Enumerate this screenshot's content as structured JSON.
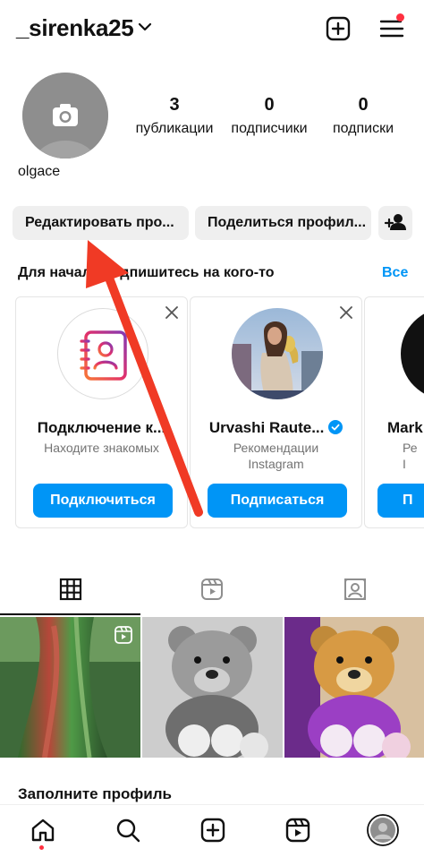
{
  "header": {
    "username": "_sirenka25",
    "icons": {
      "dropdown": "chevron-down-icon",
      "create": "plus-square-icon",
      "menu": "hamburger-menu-icon"
    }
  },
  "profile": {
    "name": "olgace",
    "stats": [
      {
        "value": "3",
        "label": "публикации"
      },
      {
        "value": "0",
        "label": "подписчики"
      },
      {
        "value": "0",
        "label": "подписки"
      }
    ]
  },
  "buttons": {
    "edit_profile": "Редактировать про...",
    "share_profile": "Поделиться профил...",
    "add_person_icon": "add-person-icon"
  },
  "discover": {
    "title": "Для начала подпишитесь на кого-то",
    "see_all": "Все",
    "cards": [
      {
        "name": "Подключение к...",
        "subtitle_line1": "Находите знакомых",
        "subtitle_line2": "",
        "button": "Подключиться"
      },
      {
        "name": "Urvashi Raute...",
        "subtitle_line1": "Рекомендации",
        "subtitle_line2": "Instagram",
        "button": "Подписаться",
        "verified": true
      },
      {
        "name": "Mark",
        "subtitle_line1": "Ре",
        "subtitle_line2": "I",
        "button": "П"
      }
    ]
  },
  "tabs": [
    {
      "name": "posts",
      "icon": "grid-icon",
      "active": true
    },
    {
      "name": "reels",
      "icon": "reels-icon",
      "active": false
    },
    {
      "name": "tagged",
      "icon": "tagged-person-icon",
      "active": false
    }
  ],
  "complete_profile": "Заполните профиль",
  "bottom_nav": [
    "home-icon",
    "search-icon",
    "create-icon",
    "reels-icon",
    "profile-avatar"
  ],
  "colors": {
    "accent": "#0095f6",
    "notification": "#ff3040",
    "arrow": "#f03a25"
  }
}
